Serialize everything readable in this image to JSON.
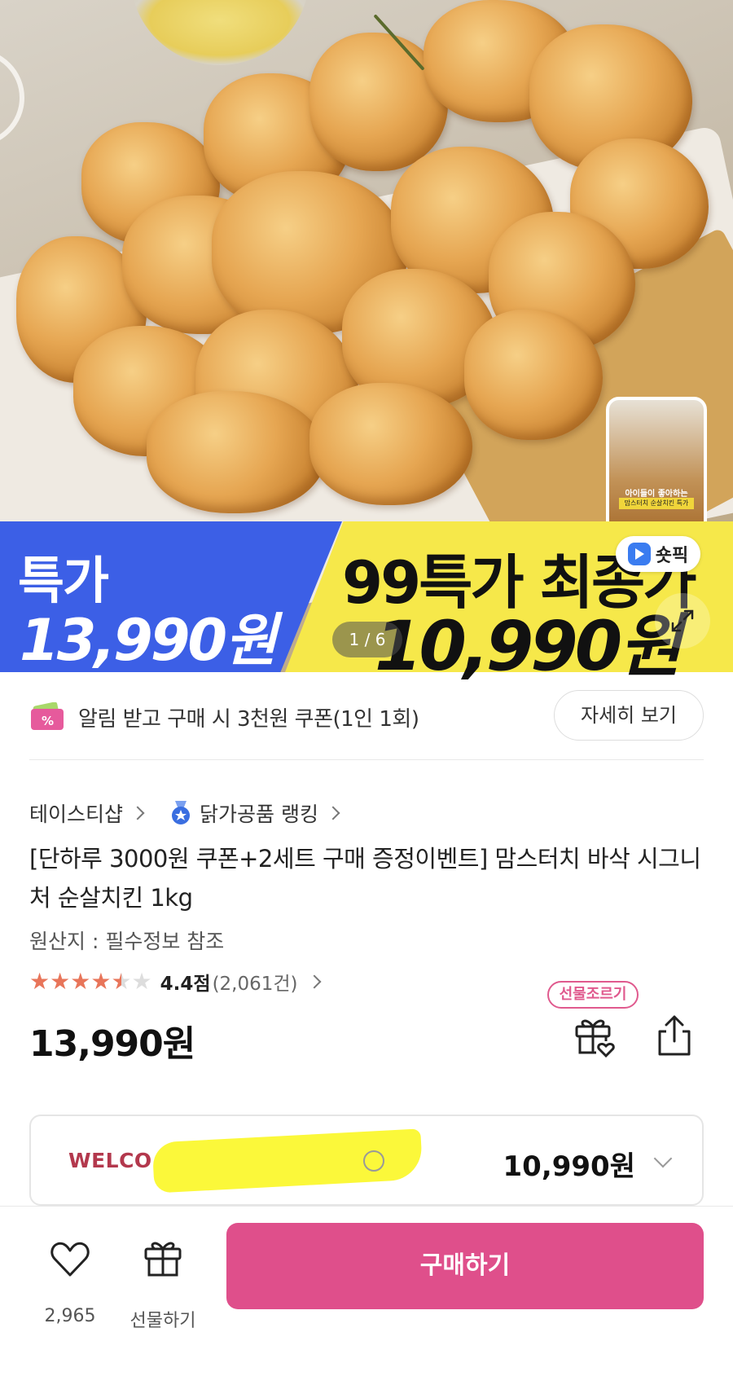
{
  "hero": {
    "tag_label": "특가",
    "tag_price": "13,990원",
    "promo_label": "99특가 최종가",
    "promo_price": "10,990원",
    "image_counter": "1 / 6",
    "shorts_caption_1": "아이들이 좋아하는",
    "shorts_caption_2": "맘스터치 순살치킨 특가",
    "shorts_label": "숏픽"
  },
  "coupon_banner": {
    "text": "알림 받고 구매 시 3천원 쿠폰(1인 1회)",
    "detail_button": "자세히 보기"
  },
  "product": {
    "seller": "테이스티샵",
    "ranking": "닭가공품 랭킹",
    "title": "[단하루 3000원 쿠폰+2세트 구매 증정이벤트] 맘스터치 바삭 시그니처 순살치킨 1kg",
    "origin": "원산지 : 필수정보 참조",
    "rating_score": "4.4점",
    "rating_count": "(2,061건)",
    "rating_value": 4.4,
    "price": "13,990원",
    "gift_badge": "선물조르기"
  },
  "coupon_select": {
    "label": "WELCO",
    "amount": "10,990원"
  },
  "bottom_bar": {
    "like_count": "2,965",
    "gift_label": "선물하기",
    "buy_label": "구매하기"
  },
  "colors": {
    "accent_pink": "#df4f8b",
    "banner_blue": "#3c5fe6",
    "banner_yellow": "#f6e84a",
    "star": "#e8755a"
  },
  "icons": [
    "expand-icon",
    "play-icon",
    "coupon-icon",
    "ranking-medal-icon",
    "chevron-right-icon",
    "star-icon",
    "gift-icon",
    "share-icon",
    "info-icon",
    "chevron-down-icon",
    "heart-icon"
  ]
}
